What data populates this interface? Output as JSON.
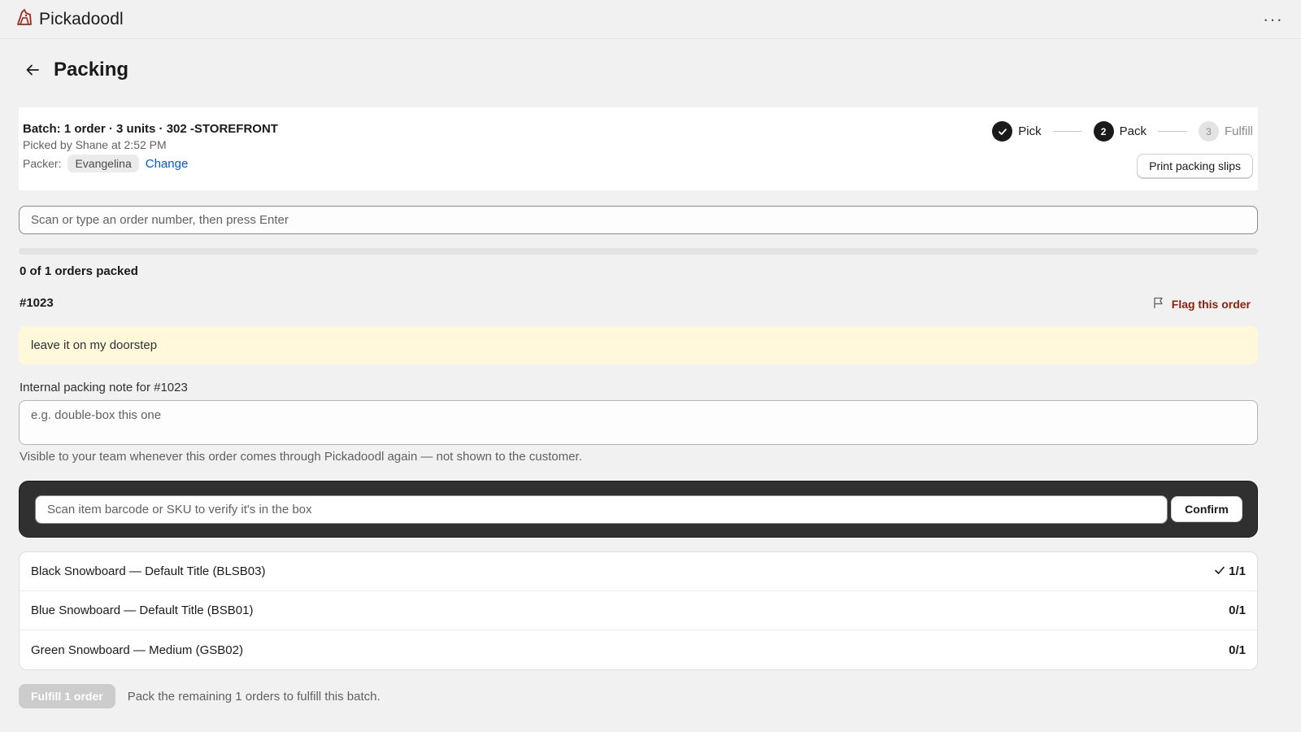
{
  "app": {
    "name": "Pickadoodl"
  },
  "page": {
    "title": "Packing"
  },
  "batch": {
    "title": "Batch: 1 order · 3 units · 302 -STOREFRONT",
    "picked_by": "Picked by Shane at 2:52 PM",
    "packer_label": "Packer:",
    "packer_name": "Evangelina",
    "change_label": "Change",
    "print_label": "Print packing slips"
  },
  "stepper": {
    "steps": [
      {
        "label": "Pick",
        "state": "done",
        "number": ""
      },
      {
        "label": "Pack",
        "state": "active",
        "number": "2"
      },
      {
        "label": "Fulfill",
        "state": "todo",
        "number": "3"
      }
    ]
  },
  "order_scan": {
    "placeholder": "Scan or type an order number, then press Enter"
  },
  "progress": {
    "packed": 0,
    "total": 1,
    "label": "0 of 1 orders packed"
  },
  "order": {
    "number": "#1023",
    "flag_label": "Flag this order",
    "customer_note": "leave it on my doorstep",
    "internal_note_label": "Internal packing note for #1023",
    "internal_note_placeholder": "e.g. double-box this one",
    "internal_note_help": "Visible to your team whenever this order comes through Pickadoodl again — not shown to the customer."
  },
  "item_scan": {
    "placeholder": "Scan item barcode or SKU to verify it's in the box",
    "confirm_label": "Confirm"
  },
  "items": [
    {
      "name": "Black Snowboard — Default Title (BLSB03)",
      "qty": "1/1",
      "verified": true
    },
    {
      "name": "Blue Snowboard — Default Title (BSB01)",
      "qty": "0/1",
      "verified": false
    },
    {
      "name": "Green Snowboard — Medium (GSB02)",
      "qty": "0/1",
      "verified": false
    }
  ],
  "footer": {
    "fulfill_label": "Fulfill 1 order",
    "note": "Pack the remaining 1 orders to fulfill this batch."
  },
  "colors": {
    "link": "#005bd3",
    "flag": "#8e1f0b",
    "note_banner": "#fff8db",
    "scan_panel": "#303030"
  },
  "icons": {
    "brand": "pickadoodl-logo-icon",
    "menu": "more-horizontal-icon",
    "back": "arrow-left-icon",
    "flag": "flag-icon",
    "check": "checkmark-icon"
  }
}
